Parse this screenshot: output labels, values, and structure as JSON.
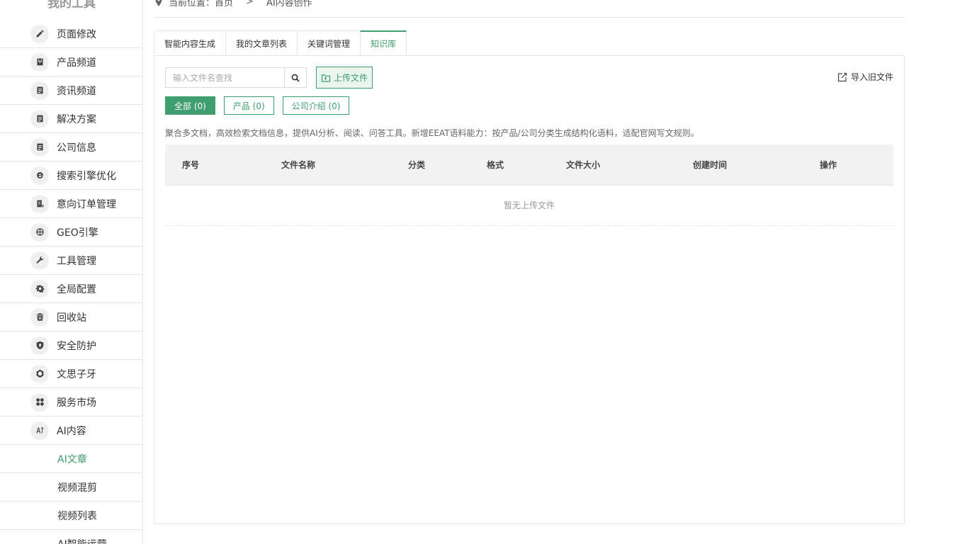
{
  "sidebar": {
    "title": "我的工具",
    "items": [
      {
        "label": "页面修改",
        "icon": "edit-icon"
      },
      {
        "label": "产品频道",
        "icon": "bag-icon"
      },
      {
        "label": "资讯频道",
        "icon": "document-icon"
      },
      {
        "label": "解决方案",
        "icon": "document-icon"
      },
      {
        "label": "公司信息",
        "icon": "document-icon"
      },
      {
        "label": "搜索引擎优化",
        "icon": "ie-icon"
      },
      {
        "label": "意向订单管理",
        "icon": "order-icon"
      },
      {
        "label": "GEO引擎",
        "icon": "globe-icon"
      },
      {
        "label": "工具管理",
        "icon": "wrench-icon"
      },
      {
        "label": "全局配置",
        "icon": "gear-icon"
      },
      {
        "label": "回收站",
        "icon": "trash-icon"
      },
      {
        "label": "安全防护",
        "icon": "shield-icon"
      },
      {
        "label": "文思子牙",
        "icon": "hexagon-icon"
      },
      {
        "label": "服务市场",
        "icon": "grid-icon"
      },
      {
        "label": "AI内容",
        "icon": "ai-icon"
      }
    ],
    "sub_items": [
      {
        "label": "AI文章",
        "active": true
      },
      {
        "label": "视频混剪",
        "active": false
      },
      {
        "label": "视频列表",
        "active": false
      },
      {
        "label": "AI智能运营",
        "active": false
      }
    ]
  },
  "breadcrumb": {
    "prefix": "当前位置：",
    "home": "首页",
    "separator": ">",
    "current": "AI内容创作"
  },
  "tabs": [
    {
      "label": "智能内容生成",
      "active": false
    },
    {
      "label": "我的文章列表",
      "active": false
    },
    {
      "label": "关键词管理",
      "active": false
    },
    {
      "label": "知识库",
      "active": true
    }
  ],
  "toolbar": {
    "search_placeholder": "输入文件名查找",
    "upload_label": "上传文件",
    "import_label": "导入旧文件"
  },
  "filters": [
    {
      "label": "全部 (0)",
      "active": true
    },
    {
      "label": "产品 (0)",
      "active": false
    },
    {
      "label": "公司介绍 (0)",
      "active": false
    }
  ],
  "description": "聚合多文档，高效检索文档信息，提供AI分析、阅读、问答工具。新增EEAT语料能力：按产品/公司分类生成结构化语料，适配官网写文规则。",
  "table": {
    "columns": [
      "序号",
      "文件名称",
      "分类",
      "格式",
      "文件大小",
      "创建时间",
      "操作"
    ],
    "empty_text": "暂无上传文件"
  },
  "colors": {
    "accent": "#3f9d6f"
  }
}
